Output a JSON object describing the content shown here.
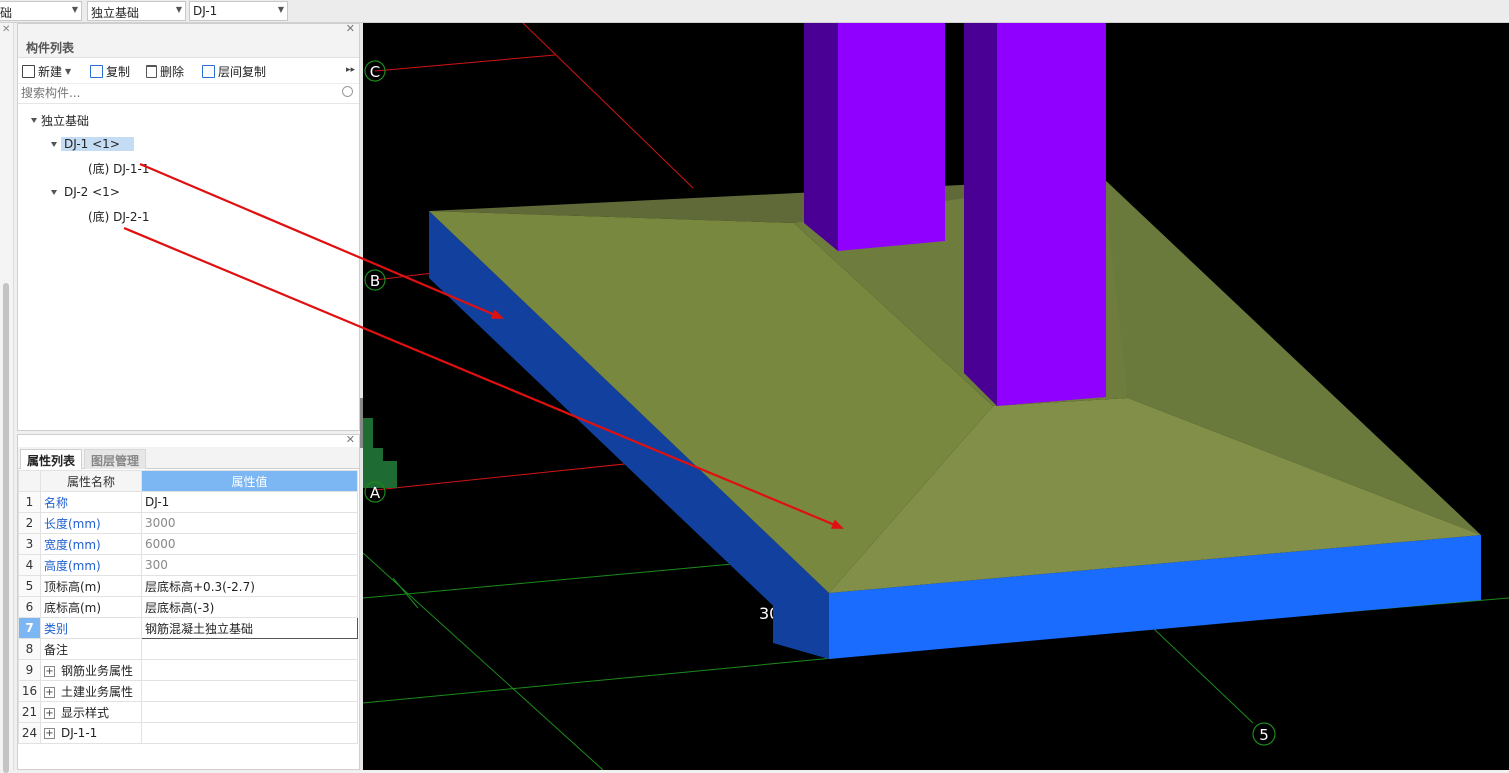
{
  "toolbar": {
    "combo1": "础",
    "combo2": "独立基础",
    "combo3": "DJ-1"
  },
  "component_panel": {
    "title": "构件列表",
    "buttons": {
      "new": "新建",
      "copy": "复制",
      "delete": "删除",
      "copy_floor": "层间复制"
    },
    "search_placeholder": "搜索构件...",
    "tree": {
      "root": "独立基础",
      "items": [
        {
          "label": "DJ-1  <1>",
          "child": "(底) DJ-1-1",
          "selected": true
        },
        {
          "label": "DJ-2  <1>",
          "child": "(底) DJ-2-1",
          "selected": false
        }
      ]
    }
  },
  "property_panel": {
    "tabs": [
      "属性列表",
      "图层管理"
    ],
    "headers": {
      "name": "属性名称",
      "value": "属性值"
    },
    "rows": [
      {
        "num": "1",
        "name": "名称",
        "value": "DJ-1"
      },
      {
        "num": "2",
        "name": "长度(mm)",
        "value": "3000"
      },
      {
        "num": "3",
        "name": "宽度(mm)",
        "value": "6000"
      },
      {
        "num": "4",
        "name": "高度(mm)",
        "value": "300"
      },
      {
        "num": "5",
        "name": "顶标高(m)",
        "value": "层底标高+0.3(-2.7)"
      },
      {
        "num": "6",
        "name": "底标高(m)",
        "value": "层底标高(-3)"
      },
      {
        "num": "7",
        "name": "类别",
        "value": "钢筋混凝土独立基础"
      },
      {
        "num": "8",
        "name": "备注",
        "value": ""
      },
      {
        "num": "9",
        "name": "钢筋业务属性",
        "value": ""
      },
      {
        "num": "16",
        "name": "土建业务属性",
        "value": ""
      },
      {
        "num": "21",
        "name": "显示样式",
        "value": ""
      },
      {
        "num": "24",
        "name": "DJ-1-1",
        "value": ""
      }
    ]
  },
  "viewport": {
    "axis_labels": {
      "c": "C",
      "b": "B",
      "a": "A",
      "five": "5"
    },
    "dimension_text": "300",
    "colors": {
      "background": "#000000",
      "slab_top": "#7c8a46",
      "slab_side_dark": "#12409e",
      "slab_side_light": "#1a6cff",
      "column_front": "#8f00ff",
      "column_side": "#4b0095",
      "grid_red": "#d11414",
      "grid_green": "#1c8a1c",
      "arrow_red": "#e01010"
    }
  }
}
